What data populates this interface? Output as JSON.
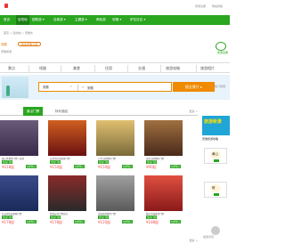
{
  "top_links": [
    "登录注册",
    "网站导航"
  ],
  "nav": {
    "items": [
      {
        "label": "首页",
        "active": false
      },
      {
        "label": "目的地",
        "active": true
      },
      {
        "label": "团购游 ▾",
        "active": false
      },
      {
        "label": "自助游 ▾",
        "active": false
      },
      {
        "label": "主题游 ▾",
        "active": false
      },
      {
        "label": "邮轮游",
        "active": false
      },
      {
        "label": "攻略 ▾",
        "active": false
      },
      {
        "label": "驴友社区 ▾",
        "active": false
      }
    ]
  },
  "breadcrumb": "首页 > 目的地 > 安徽省",
  "city": {
    "name": "安徽",
    "tag": "我的安徽之旅",
    "subtitle": "安徽旅游"
  },
  "right_logo_text": "旅游宝典",
  "category_tabs": [
    "景点",
    "线路",
    "美食",
    "住宿",
    "交通",
    "旅游攻略",
    "旅游相片"
  ],
  "search": {
    "city_value": "安徽",
    "arrow": "▾",
    "input_value": "安徽",
    "button_label": "搜全景片 ▸",
    "hot_label": "热门搜索："
  },
  "content_tabs": {
    "active": "景点门票",
    "inactive": "特价酒店"
  },
  "more_label": "更多 >",
  "cards": [
    {
      "title": "黄山风景区门票一日游",
      "badge_l": "景点门票",
      "price": "¥218起",
      "badge_r": "立即预订",
      "color1": "#3a2a4a",
      "color2": "#6a5a7a"
    },
    {
      "title": "宏村古民居旅游门票",
      "badge_l": "景点门票",
      "price": "¥150起",
      "badge_r": "立即预订",
      "color1": "#6a1010",
      "color2": "#d06020"
    },
    {
      "title": "九华山风景区门票",
      "badge_l": "景点门票",
      "price": "¥150起",
      "badge_r": "立即预订",
      "color1": "#7a6a3a",
      "color2": "#e0c070"
    },
    {
      "title": "天柱山风景区门票",
      "badge_l": "景点门票",
      "price": "¥90起",
      "badge_r": "立即预订",
      "color1": "#4a2a1a",
      "color2": "#a07040"
    },
    {
      "title": "包公祠古迹参观门票",
      "badge_l": "景点门票",
      "price": "¥178起",
      "badge_r": "立即预订",
      "color1": "#1a2a5a",
      "color2": "#3a4a8a"
    },
    {
      "title": "西递宏村门票组合",
      "badge_l": "景点门票",
      "price": "¥178起",
      "badge_r": "立即预订",
      "color1": "#2a2a2a",
      "color2": "#8a2a2a"
    },
    {
      "title": "采石矶风景区门票",
      "badge_l": "景点门票",
      "price": "¥120起",
      "badge_r": "立即预订",
      "color1": "#5a5a5a",
      "color2": "#a0a0a0"
    },
    {
      "title": "徽州古城旅游门票",
      "badge_l": "景点门票",
      "price": "¥188起",
      "badge_r": "立即预订",
      "color1": "#8a1a1a",
      "color2": "#e05040"
    }
  ],
  "side": {
    "ad_title": "旅游新景",
    "head": "安徽旅游攻略",
    "boxes": [
      "黄山",
      "皖"
    ],
    "bottom": "发送问问"
  }
}
